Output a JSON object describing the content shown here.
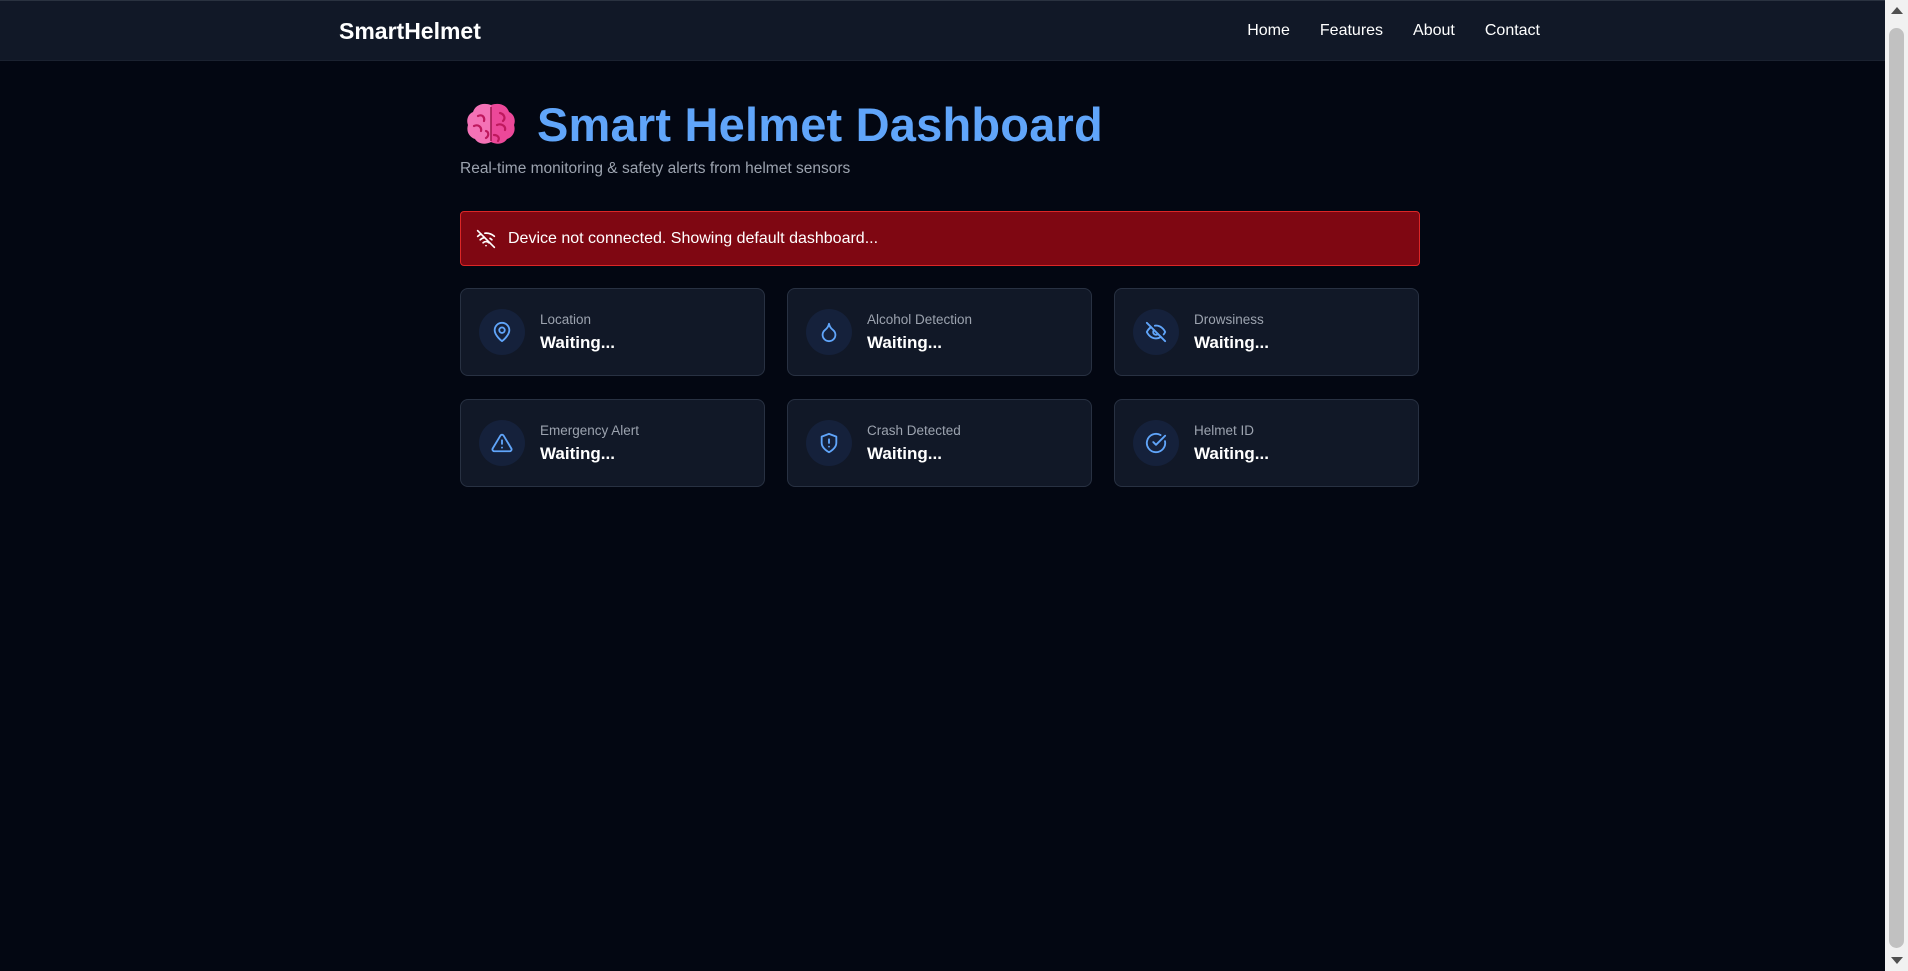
{
  "header": {
    "brand": "SmartHelmet",
    "nav": [
      "Home",
      "Features",
      "About",
      "Contact"
    ]
  },
  "main": {
    "title": "Smart Helmet Dashboard",
    "title_icon": "brain-emoji",
    "subtitle": "Real-time monitoring & safety alerts from helmet sensors",
    "alert": {
      "icon": "wifi-off-icon",
      "text": "Device not connected. Showing default dashboard..."
    },
    "cards": [
      {
        "icon": "map-pin-icon",
        "label": "Location",
        "value": "Waiting..."
      },
      {
        "icon": "droplet-icon",
        "label": "Alcohol Detection",
        "value": "Waiting..."
      },
      {
        "icon": "eye-off-icon",
        "label": "Drowsiness",
        "value": "Waiting..."
      },
      {
        "icon": "alert-triangle-icon",
        "label": "Emergency Alert",
        "value": "Waiting..."
      },
      {
        "icon": "shield-alert-icon",
        "label": "Crash Detected",
        "value": "Waiting..."
      },
      {
        "icon": "check-circle-icon",
        "label": "Helmet ID",
        "value": "Waiting..."
      }
    ]
  },
  "colors": {
    "background": "#030712",
    "header": "#111827",
    "accent": "#60a5fa",
    "alert_bg": "#7f0712",
    "alert_border": "#dc2626",
    "card_bg": "#111827"
  }
}
